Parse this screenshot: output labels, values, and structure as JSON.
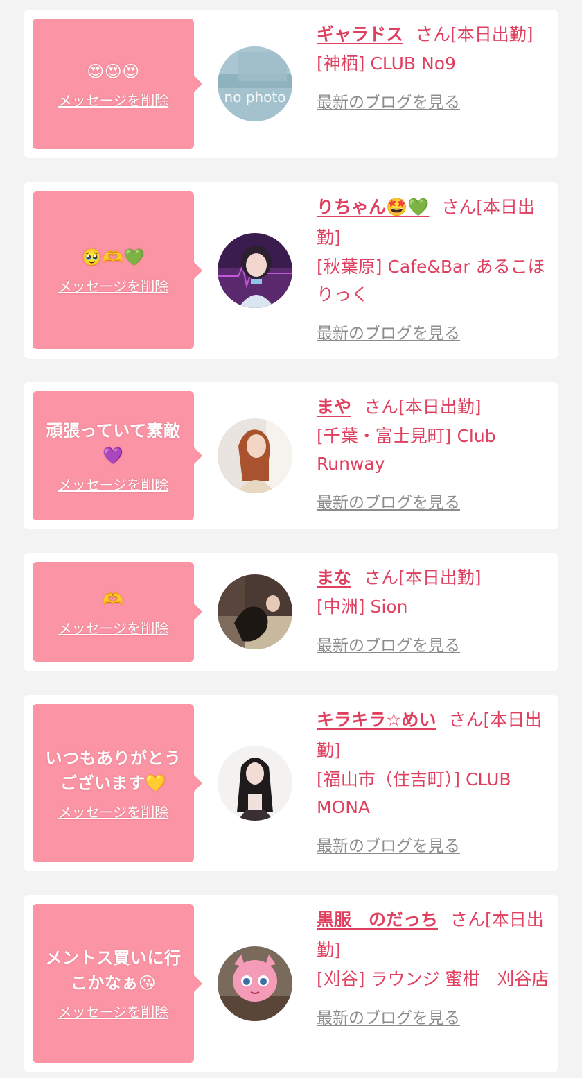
{
  "colors": {
    "page_bg": "#f3f3f3",
    "card_bg": "#ffffff",
    "bubble_bg": "#fb94a4",
    "accent": "#e0405f",
    "link_gray": "#8c8c8c"
  },
  "delete_label": "メッセージを削除",
  "blog_label": "最新のブログを見る",
  "items": [
    {
      "message": "😍😍😍",
      "name": "ギャラドス",
      "honorific": "さん",
      "status": "[本日出勤]",
      "shop": "[神栖] CLUB No9",
      "avatar_label": "no photo"
    },
    {
      "message": "🥹🫶💚",
      "name": "りちゃん🤩💚",
      "honorific": "さん",
      "status": "[本日出勤]",
      "shop": "[秋葉原] Cafe&Bar あるこほりっく"
    },
    {
      "message": "頑張っていて素敵💜",
      "name": "まや",
      "honorific": "さん",
      "status": "[本日出勤]",
      "shop": "[千葉・富士見町] Club Runway"
    },
    {
      "message": "🫶",
      "name": "まな",
      "honorific": "さん",
      "status": "[本日出勤]",
      "shop": "[中洲] Sion"
    },
    {
      "message": "いつもありがとうございます💛",
      "name": "キラキラ☆めい",
      "honorific": "さん",
      "status": "[本日出勤]",
      "shop": "[福山市（住吉町）] CLUB MONA"
    },
    {
      "message": "メントス買いに行こかなぁ😘",
      "name": "黒服　のだっち",
      "honorific": "さん",
      "status": "[本日出勤]",
      "shop": "[刈谷] ラウンジ 蜜柑　刈谷店"
    }
  ]
}
